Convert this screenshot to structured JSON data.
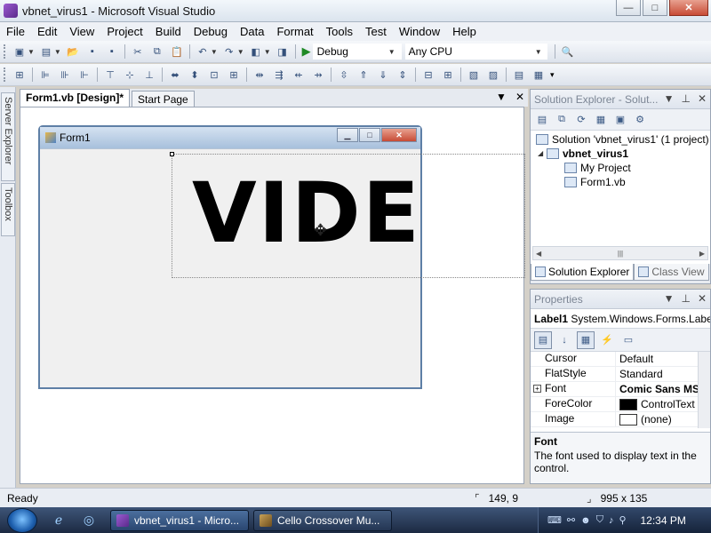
{
  "window": {
    "title": "vbnet_virus1 - Microsoft Visual Studio",
    "minimize": "—",
    "maximize": "□",
    "close": "✕"
  },
  "menu": [
    "File",
    "Edit",
    "View",
    "Project",
    "Build",
    "Debug",
    "Data",
    "Format",
    "Tools",
    "Test",
    "Window",
    "Help"
  ],
  "toolbar": {
    "configuration": "Debug",
    "platform": "Any CPU"
  },
  "left_tabs": {
    "server_explorer": "Server Explorer",
    "toolbox": "Toolbox"
  },
  "documents": {
    "tabs": [
      "Form1.vb [Design]*",
      "Start Page"
    ],
    "active_tab": 0
  },
  "designer": {
    "form_title": "Form1",
    "label_text": "VIDEO"
  },
  "solution_explorer": {
    "title": "Solution Explorer - Solut...",
    "tree": {
      "solution": "Solution 'vbnet_virus1' (1 project)",
      "project": "vbnet_virus1",
      "items": [
        "My Project",
        "Form1.vb"
      ]
    },
    "tabs": [
      "Solution Explorer",
      "Class View"
    ]
  },
  "properties": {
    "title": "Properties",
    "object": "Label1",
    "object_type": "System.Windows.Forms.Label",
    "rows": [
      {
        "name": "Cursor",
        "value": "Default"
      },
      {
        "name": "FlatStyle",
        "value": "Standard"
      },
      {
        "name": "Font",
        "value": "Comic Sans MS"
      },
      {
        "name": "ForeColor",
        "value": "ControlText"
      },
      {
        "name": "Image",
        "value": "(none)"
      }
    ],
    "colors": {
      "forecolor_swatch": "#000000",
      "image_swatch": "#ffffff"
    },
    "description_title": "Font",
    "description_text": "The font used to display text in the control."
  },
  "status": {
    "text": "Ready",
    "position": "149, 9",
    "size": "995 x 135"
  },
  "taskbar": {
    "buttons": [
      "vbnet_virus1 - Micro...",
      "Cello Crossover Mu..."
    ],
    "clock": "12:34 PM"
  }
}
